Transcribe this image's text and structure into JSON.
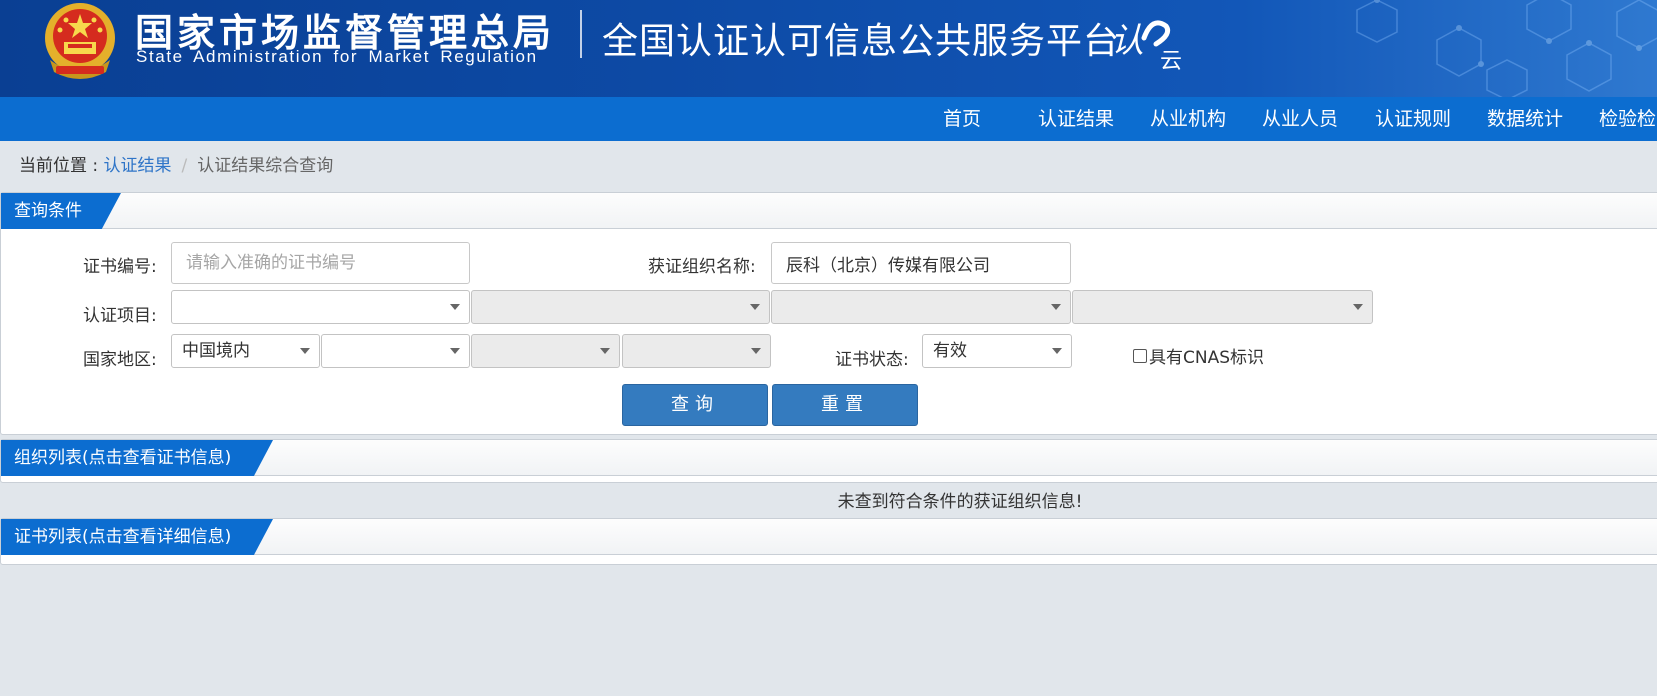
{
  "header": {
    "org_name_cn": "国家市场监督管理总局",
    "org_name_en": "State Administration  for  Market Regulation",
    "platform_title": "全国认证认可信息公共服务平台",
    "logo_text": "认云",
    "brand_color": "#0d4aa5"
  },
  "nav": {
    "items": [
      "首页",
      "认证结果",
      "从业机构",
      "从业人员",
      "认证规则",
      "数据统计",
      "检验检"
    ],
    "bg_color": "#0c6dd0"
  },
  "breadcrumb": {
    "prefix": "当前位置 : ",
    "link": "认证结果",
    "separator": "/",
    "current": "认证结果综合查询"
  },
  "query_panel": {
    "title": "查询条件",
    "cert_number": {
      "label": "证书编号:",
      "placeholder": "请输入准确的证书编号",
      "value": ""
    },
    "org_name": {
      "label": "获证组织名称:",
      "value": "辰科（北京）传媒有限公司"
    },
    "cert_project": {
      "label": "认证项目:",
      "selects": [
        "",
        "",
        "",
        ""
      ]
    },
    "region": {
      "label": "国家地区:",
      "selects": [
        "中国境内",
        "",
        "",
        ""
      ]
    },
    "cert_status": {
      "label": "证书状态:",
      "value": "有效"
    },
    "cnas": {
      "label": "具有CNAS标识",
      "checked": false
    },
    "buttons": {
      "search": "查询",
      "reset": "重置"
    }
  },
  "org_list": {
    "title": "组织列表(点击查看证书信息)",
    "empty_message": "未查到符合条件的获证组织信息!"
  },
  "cert_list": {
    "title": "证书列表(点击查看详细信息)"
  }
}
